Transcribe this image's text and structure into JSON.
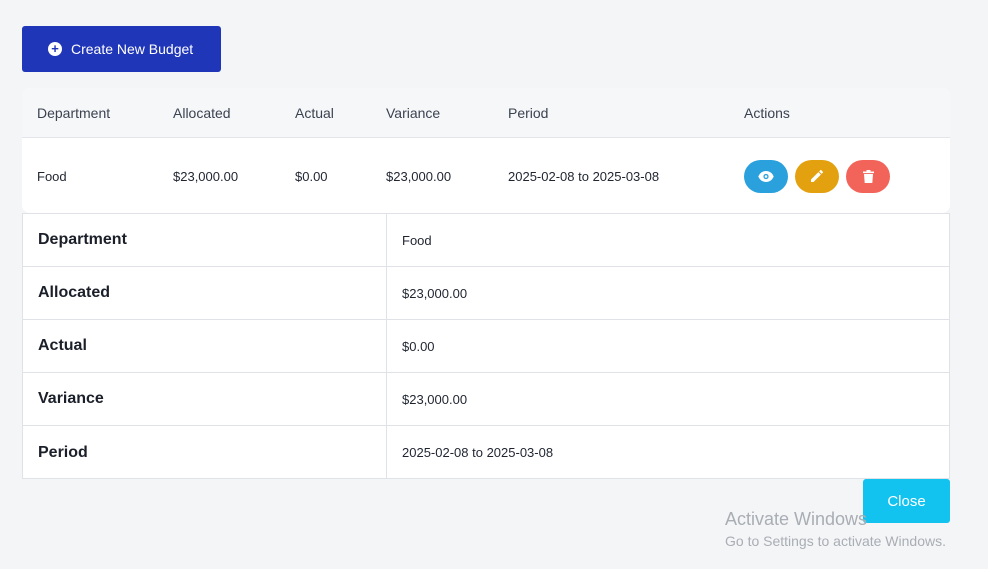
{
  "toolbar": {
    "create_label": "Create New Budget",
    "create_icon": "plus-circle-icon"
  },
  "table": {
    "headers": [
      "Department",
      "Allocated",
      "Actual",
      "Variance",
      "Period",
      "Actions"
    ],
    "rows": [
      {
        "department": "Food",
        "allocated": "$23,000.00",
        "actual": "$0.00",
        "variance": "$23,000.00",
        "period": "2025-02-08 to 2025-03-08",
        "actions": [
          "eye-icon",
          "pencil-icon",
          "trash-icon"
        ]
      }
    ]
  },
  "detail": {
    "rows": [
      {
        "label": "Department",
        "value": "Food"
      },
      {
        "label": "Allocated",
        "value": "$23,000.00"
      },
      {
        "label": "Actual",
        "value": "$0.00"
      },
      {
        "label": "Variance",
        "value": "$23,000.00"
      },
      {
        "label": "Period",
        "value": "2025-02-08 to 2025-03-08"
      }
    ]
  },
  "modal": {
    "close_label": "Close"
  },
  "watermark": {
    "title": "Activate Windows",
    "subtitle": "Go to Settings to activate Windows."
  },
  "colors": {
    "primary": "#2036b8",
    "view": "#2aa0dc",
    "edit": "#e3a10f",
    "delete": "#f2645a",
    "close": "#12c3f0"
  }
}
